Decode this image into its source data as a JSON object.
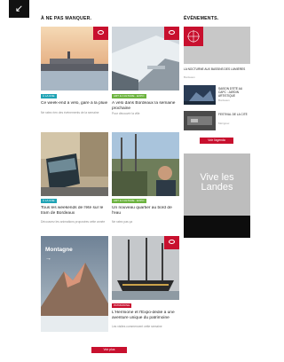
{
  "sections": {
    "not_to_miss": "À NE PAS MANQUER.",
    "events": "ÉVÈNEMENTS."
  },
  "cards": [
    {
      "tag": "À LA UNE",
      "tag_color": "#1fa3b5",
      "title": "Ce week-end à vélo, gare à la pluie",
      "meta": "Ne ratez rien des événements de la semaine"
    },
    {
      "tag": "ART & CULTURE · EXPO",
      "tag_color": "#6cb33f",
      "title": "À vélo dans Bordeaux la semaine prochaine",
      "meta": "Pour découvrir la ville"
    },
    {
      "tag": "À LA UNE",
      "tag_color": "#1fa3b5",
      "title": "Tous les weekends de l'été sur le tram de Bordeaux",
      "meta": "Découvrez les animations proposées cette année"
    },
    {
      "tag": "ART & CULTURE · EXPO",
      "tag_color": "#6cb33f",
      "title": "Un nouveau quartier au bord de l'eau",
      "meta": "Ne ratez pas ça"
    },
    {
      "tag": "",
      "tag_color": "#1fa3b5",
      "title": "Montagne",
      "meta": ""
    },
    {
      "tag": "PATRIMOINE",
      "tag_color": "#c8102e",
      "title": "L'Hermione et l'Expo-dédié à une aventure unique du patrimoine",
      "meta": "Les visites commencent cette semaine"
    }
  ],
  "events": {
    "featured_title": "LA NOCTURNE AUX BASSINS DES LUMIÈRES",
    "featured_meta": "Bordeaux",
    "items": [
      {
        "title": "SAISON D'ÉTÉ AU CAPC : JARDIN ARTISTIQUE",
        "meta": "Bordeaux"
      },
      {
        "title": "FESTIVAL DE LA CITÉ",
        "meta": "Mérignac"
      }
    ],
    "more_label": "Voir l'agenda"
  },
  "ad": {
    "text": "Vive les Landes"
  },
  "load_more": "Voir plus",
  "icons": {
    "back": "arrow-down-left-icon",
    "favorite": "eye-icon",
    "arrow": "arrow-right-icon"
  },
  "colors": {
    "accent": "#c8102e",
    "tag_blue": "#1fa3b5",
    "tag_green": "#6cb33f"
  }
}
